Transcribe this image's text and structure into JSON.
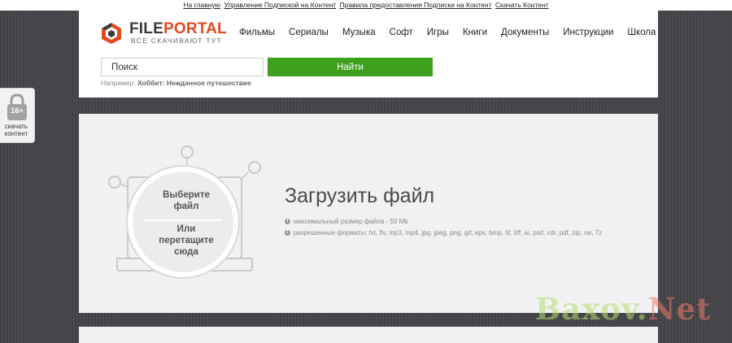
{
  "topbar": {
    "links": [
      "На главную",
      "Управление Подпиской на Контент",
      "Правила предоставления Подписки на Контент",
      "Скачать Контент"
    ]
  },
  "brand": {
    "name_part1": "FILE",
    "name_part2": "PORTAL",
    "tagline": "ВСЕ СКАЧИВАЮТ ТУТ",
    "accent_color": "#e34a1e"
  },
  "nav": {
    "items": [
      "Фильмы",
      "Сериалы",
      "Музыка",
      "Софт",
      "Игры",
      "Книги",
      "Документы",
      "Инструкции",
      "Школа"
    ]
  },
  "search": {
    "value": "Поиск",
    "button_label": "Найти",
    "button_color": "#3ca01c",
    "example_prefix": "Например:",
    "example_value": "Хоббит: Нежданное путешествие"
  },
  "upload": {
    "choose_label_1": "Выберите",
    "choose_label_2": "файл",
    "drag_label_1": "Или",
    "drag_label_2": "перетащите",
    "drag_label_3": "сюда",
    "title": "Загрузить файл",
    "max_size": "максимальный размер файла - 50 Mb",
    "formats": "разрешенные форматы: txt, flv, mp3, mp4, jpg, jpeg, png, gif, eps, bmp, tif, tiff, ai, psd, cdr, pdf, zip, rar, 7z"
  },
  "age_badge": {
    "rating": "16+",
    "label_1": "скачать",
    "label_2": "контент"
  },
  "watermark": {
    "part1": "Baxov.",
    "part2": "Net"
  }
}
